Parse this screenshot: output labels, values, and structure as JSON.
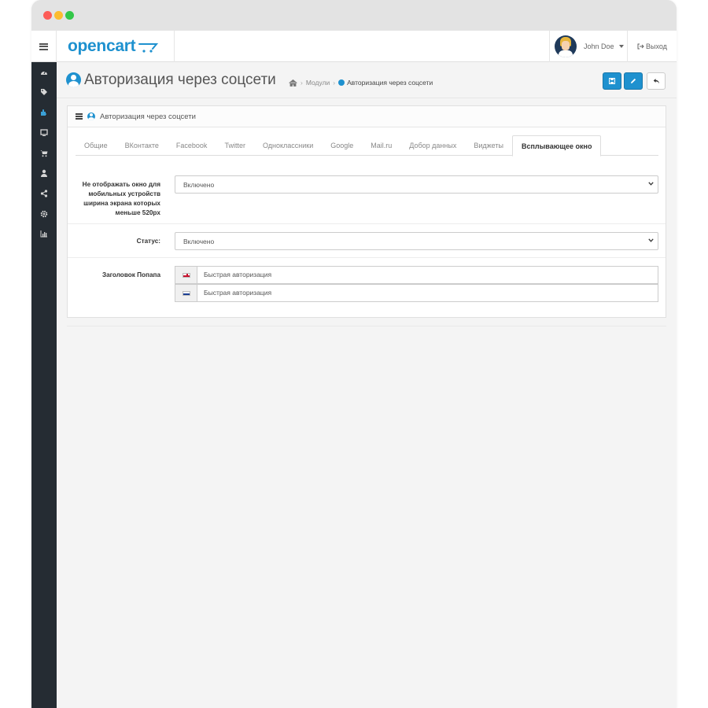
{
  "header": {
    "logo_text": "opencart",
    "user_name": "John Doe",
    "logout_label": "Выход"
  },
  "sidebar": {
    "items": [
      {
        "icon": "dashboard-icon"
      },
      {
        "icon": "tag-icon"
      },
      {
        "icon": "puzzle-icon",
        "active": true
      },
      {
        "icon": "desktop-icon"
      },
      {
        "icon": "cart-icon"
      },
      {
        "icon": "user-icon"
      },
      {
        "icon": "share-icon"
      },
      {
        "icon": "cog-icon"
      },
      {
        "icon": "bar-chart-icon"
      }
    ]
  },
  "page": {
    "title": "Авторизация через соцсети",
    "breadcrumb": {
      "modules": "Модули",
      "current": "Авторизация через соцсети"
    }
  },
  "panel": {
    "heading": "Авторизация через соцсети",
    "tabs": [
      {
        "label": "Общие"
      },
      {
        "label": "ВКонтакте"
      },
      {
        "label": "Facebook"
      },
      {
        "label": "Twitter"
      },
      {
        "label": "Одноклассники"
      },
      {
        "label": "Google"
      },
      {
        "label": "Mail.ru"
      },
      {
        "label": "Добор данных"
      },
      {
        "label": "Виджеты"
      },
      {
        "label": "Всплывающее окно",
        "active": true
      }
    ],
    "fields": {
      "mobile_hide": {
        "label": "Не отображать окно для мобильных устройств ширина экрана которых меньше 520px",
        "value": "Включено"
      },
      "status": {
        "label": "Статус:",
        "value": "Включено"
      },
      "popup_title": {
        "label": "Заголовок Попапа",
        "values": [
          {
            "flag": "en",
            "value": "Быстрая авторизация"
          },
          {
            "flag": "ru",
            "value": "Быстрая авторизация"
          }
        ]
      }
    }
  },
  "colors": {
    "primary": "#1e91cf",
    "sidebar_bg": "#252c33",
    "page_bg": "#f4f4f4"
  }
}
